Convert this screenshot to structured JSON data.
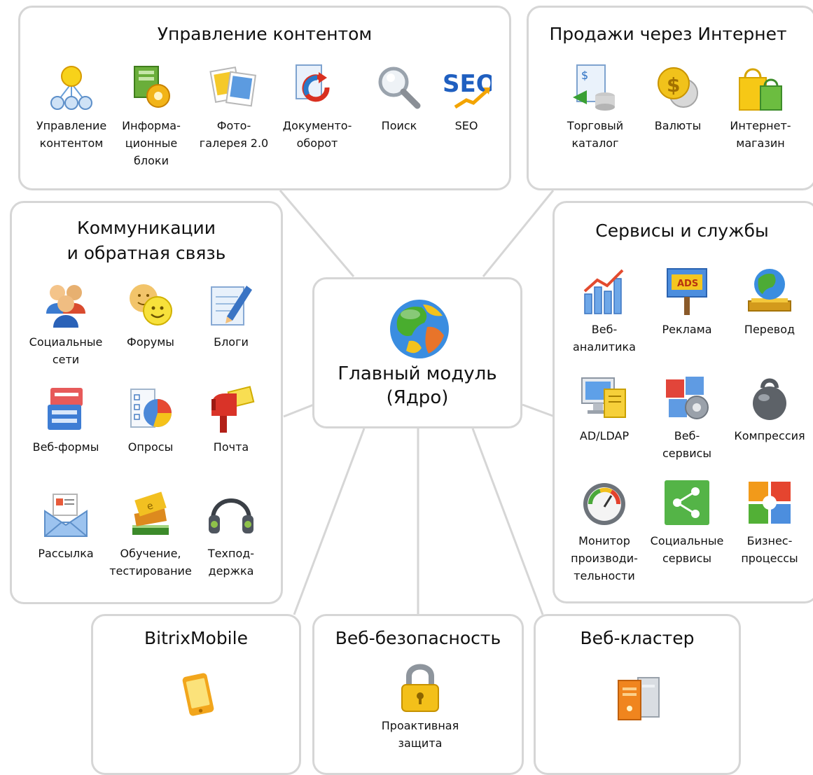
{
  "core": {
    "label": "Главный модуль\n(Ядро)",
    "icon": "globe-icon"
  },
  "groups": {
    "content": {
      "title": "Управление контентом",
      "items": [
        {
          "label": "Управление\nконтентом",
          "icon": "content-management-icon"
        },
        {
          "label": "Информа-\nционные\nблоки",
          "icon": "info-blocks-icon"
        },
        {
          "label": "Фото-\nгалерея 2.0",
          "icon": "photo-gallery-icon"
        },
        {
          "label": "Документо-\nоборот",
          "icon": "document-workflow-icon"
        },
        {
          "label": "Поиск",
          "icon": "search-icon"
        },
        {
          "label": "SEO",
          "icon": "seo-icon"
        }
      ]
    },
    "sales": {
      "title": "Продажи через Интернет",
      "items": [
        {
          "label": "Торговый\nкаталог",
          "icon": "trade-catalog-icon"
        },
        {
          "label": "Валюты",
          "icon": "currency-icon"
        },
        {
          "label": "Интернет-\nмагазин",
          "icon": "shopping-bag-icon"
        }
      ]
    },
    "communications": {
      "title": "Коммуникации\nи обратная связь",
      "items": [
        {
          "label": "Социальные\nсети",
          "icon": "social-network-icon"
        },
        {
          "label": "Форумы",
          "icon": "forum-icon"
        },
        {
          "label": "Блоги",
          "icon": "blog-icon"
        },
        {
          "label": "Веб-формы",
          "icon": "web-forms-icon"
        },
        {
          "label": "Опросы",
          "icon": "polls-icon"
        },
        {
          "label": "Почта",
          "icon": "mailbox-icon"
        },
        {
          "label": "Рассылка",
          "icon": "newsletter-icon"
        },
        {
          "label": "Обучение,\nтестирование",
          "icon": "learning-icon"
        },
        {
          "label": "Техпод-\nдержка",
          "icon": "support-headset-icon"
        }
      ]
    },
    "services": {
      "title": "Сервисы и службы",
      "items": [
        {
          "label": "Веб-\nаналитика",
          "icon": "web-analytics-icon"
        },
        {
          "label": "Реклама",
          "icon": "ads-icon"
        },
        {
          "label": "Перевод",
          "icon": "translation-icon"
        },
        {
          "label": "AD/LDAP",
          "icon": "ad-ldap-icon"
        },
        {
          "label": "Веб-\nсервисы",
          "icon": "web-services-icon"
        },
        {
          "label": "Компрессия",
          "icon": "compression-icon"
        },
        {
          "label": "Монитор\nпроизводи-\nтельности",
          "icon": "performance-monitor-icon"
        },
        {
          "label": "Социальные\nсервисы",
          "icon": "social-services-icon"
        },
        {
          "label": "Бизнес-\nпроцессы",
          "icon": "business-process-icon"
        }
      ]
    },
    "mobile": {
      "title": "BitrixMobile",
      "items": [
        {
          "label": "",
          "icon": "mobile-phone-icon"
        }
      ]
    },
    "security": {
      "title": "Веб-безопасность",
      "items": [
        {
          "label": "Проактивная\nзащита",
          "icon": "padlock-icon"
        }
      ]
    },
    "cluster": {
      "title": "Веб-кластер",
      "items": [
        {
          "label": "",
          "icon": "server-cluster-icon"
        }
      ]
    }
  }
}
